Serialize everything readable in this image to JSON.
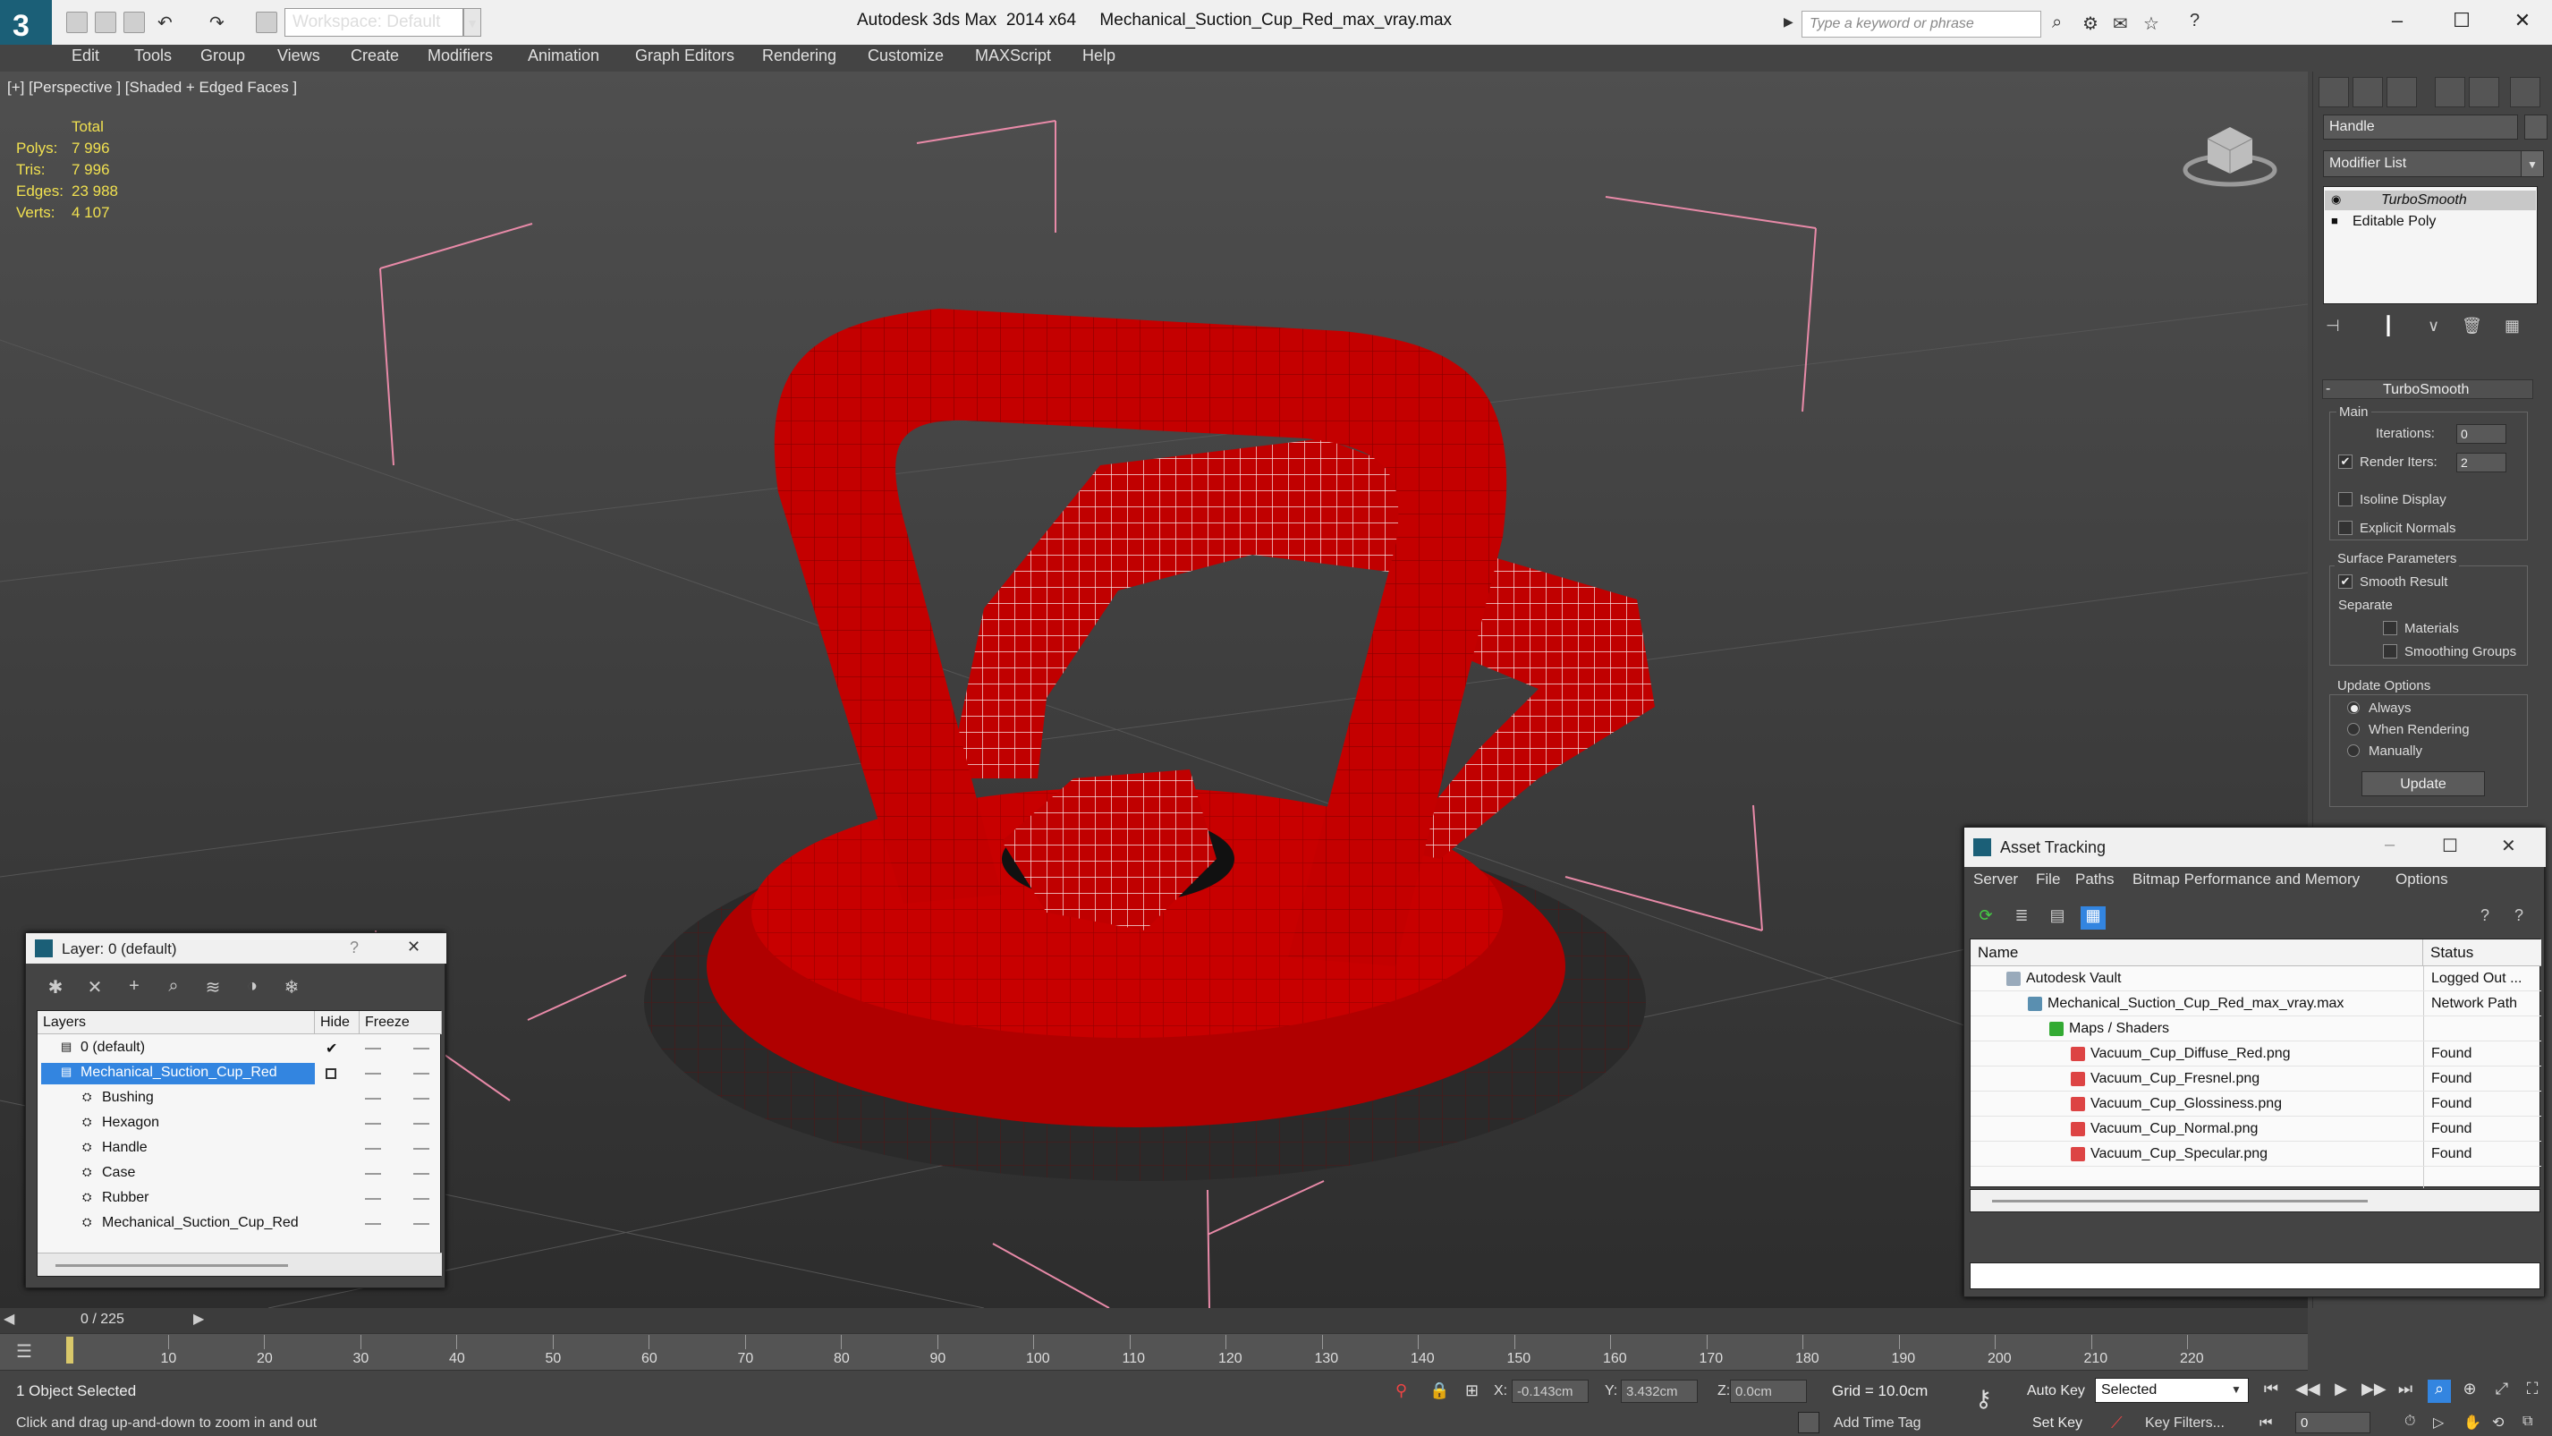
{
  "window": {
    "title": "Autodesk 3ds Max  2014 x64     Mechanical_Suction_Cup_Red_max_vray.max",
    "workspace": "Workspace: Default",
    "search_placeholder": "Type a keyword or phrase"
  },
  "menu": [
    "Edit",
    "Tools",
    "Group",
    "Views",
    "Create",
    "Modifiers",
    "Animation",
    "Graph Editors",
    "Rendering",
    "Customize",
    "MAXScript",
    "Help"
  ],
  "viewport": {
    "label": "[+] [Perspective ] [Shaded + Edged Faces ]",
    "stats": {
      "header": "Total",
      "rows": [
        {
          "k": "Polys:",
          "v": "7 996"
        },
        {
          "k": "Tris:",
          "v": "7 996"
        },
        {
          "k": "Edges:",
          "v": "23 988"
        },
        {
          "k": "Verts:",
          "v": "4 107"
        }
      ]
    }
  },
  "command_panel": {
    "object_name": "Handle",
    "modifier_list": "Modifier List",
    "stack": [
      "TurboSmooth",
      "Editable Poly"
    ],
    "rollout": "TurboSmooth",
    "main_label": "Main",
    "iterations_label": "Iterations:",
    "iterations": "0",
    "render_iters_label": "Render Iters:",
    "render_iters": "2",
    "isoline": "Isoline Display",
    "explicit_normals": "Explicit Normals",
    "surface_params": "Surface Parameters",
    "smooth_result": "Smooth Result",
    "separate": "Separate",
    "materials": "Materials",
    "smoothing_groups": "Smoothing Groups",
    "update_options": "Update Options",
    "always": "Always",
    "when_rendering": "When Rendering",
    "manually": "Manually",
    "update_button": "Update"
  },
  "layer_window": {
    "title": "Layer: 0 (default)",
    "help": "?",
    "close": "✕",
    "columns": [
      "Layers",
      "Hide",
      "Freeze"
    ],
    "rows": [
      {
        "name": "0 (default)",
        "indent": 1,
        "check": "✔"
      },
      {
        "name": "Mechanical_Suction_Cup_Red",
        "indent": 1,
        "selected": true
      },
      {
        "name": "Bushing",
        "indent": 2
      },
      {
        "name": "Hexagon",
        "indent": 2
      },
      {
        "name": "Handle",
        "indent": 2
      },
      {
        "name": "Case",
        "indent": 2
      },
      {
        "name": "Rubber",
        "indent": 2
      },
      {
        "name": "Mechanical_Suction_Cup_Red",
        "indent": 2
      }
    ]
  },
  "asset_tracking": {
    "title": "Asset Tracking",
    "menu": [
      "Server",
      "File",
      "Paths",
      "Bitmap Performance and Memory",
      "Options"
    ],
    "columns": [
      "Name",
      "Status"
    ],
    "rows": [
      {
        "name": "Autodesk Vault",
        "status": "Logged Out ...",
        "indent": 1,
        "icon": "vault"
      },
      {
        "name": "Mechanical_Suction_Cup_Red_max_vray.max",
        "status": "Network Path",
        "indent": 2,
        "icon": "max"
      },
      {
        "name": "Maps / Shaders",
        "status": "",
        "indent": 3,
        "icon": "folder"
      },
      {
        "name": "Vacuum_Cup_Diffuse_Red.png",
        "status": "Found",
        "indent": 4,
        "icon": "png"
      },
      {
        "name": "Vacuum_Cup_Fresnel.png",
        "status": "Found",
        "indent": 4,
        "icon": "png"
      },
      {
        "name": "Vacuum_Cup_Glossiness.png",
        "status": "Found",
        "indent": 4,
        "icon": "png"
      },
      {
        "name": "Vacuum_Cup_Normal.png",
        "status": "Found",
        "indent": 4,
        "icon": "png"
      },
      {
        "name": "Vacuum_Cup_Specular.png",
        "status": "Found",
        "indent": 4,
        "icon": "png"
      }
    ]
  },
  "timeline": {
    "frame_label": "0 / 225",
    "ticks": [
      "10",
      "20",
      "30",
      "40",
      "50",
      "60",
      "70",
      "80",
      "90",
      "100",
      "110",
      "120",
      "130",
      "140",
      "150",
      "160",
      "170",
      "180",
      "190",
      "200",
      "210",
      "220"
    ]
  },
  "status": {
    "selection": "1 Object Selected",
    "prompt": "Click and drag up-and-down to zoom in and out",
    "x_label": "X:",
    "x": "-0.143cm",
    "y_label": "Y:",
    "y": "3.432cm",
    "z_label": "Z:",
    "z": "0.0cm",
    "grid": "Grid = 10.0cm",
    "add_time_tag": "Add Time Tag",
    "auto_key": "Auto Key",
    "set_key": "Set Key",
    "selected": "Selected",
    "key_filters": "Key Filters...",
    "frame": "0"
  },
  "colors": {
    "model_red": "#c80000",
    "wire": "#ffffff",
    "gizmo": "#e88aa8",
    "stats_yellow": "#f0e050",
    "selection_blue": "#3385e0"
  }
}
